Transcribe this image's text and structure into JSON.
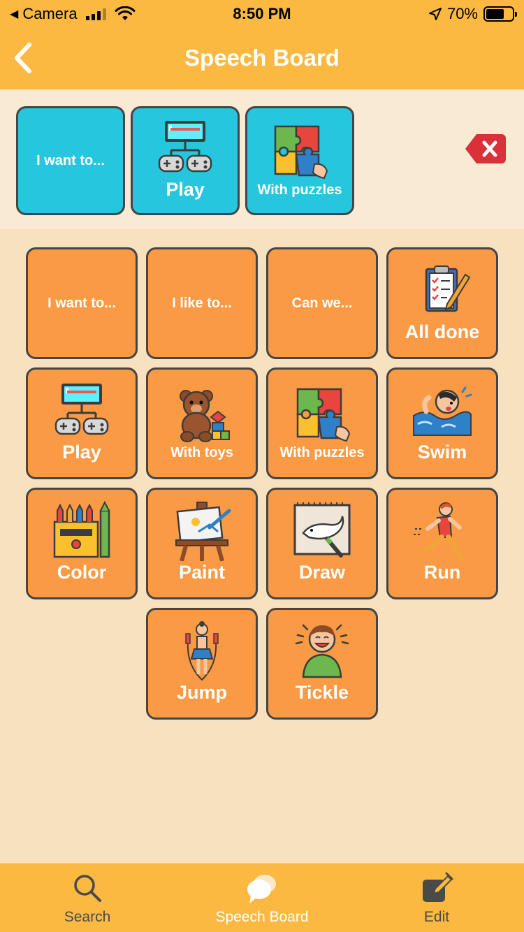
{
  "status_bar": {
    "back_app": "Camera",
    "time": "8:50 PM",
    "battery": "70%",
    "battery_level": 0.7
  },
  "nav": {
    "title": "Speech Board",
    "back_icon": "chevron-left-icon"
  },
  "sentence": [
    {
      "label": "I want to...",
      "icon": null
    },
    {
      "label": "Play",
      "icon": "game-console-icon"
    },
    {
      "label": "With puzzles",
      "icon": "puzzle-icon"
    }
  ],
  "delete_icon": "backspace-icon",
  "grid": [
    {
      "label": "I want to...",
      "icon": null
    },
    {
      "label": "I like to...",
      "icon": null
    },
    {
      "label": "Can we...",
      "icon": null
    },
    {
      "label": "All done",
      "icon": "checklist-icon"
    },
    {
      "label": "Play",
      "icon": "game-console-icon"
    },
    {
      "label": "With toys",
      "icon": "teddy-bear-icon"
    },
    {
      "label": "With puzzles",
      "icon": "puzzle-icon"
    },
    {
      "label": "Swim",
      "icon": "swimmer-icon"
    },
    {
      "label": "Color",
      "icon": "crayons-icon"
    },
    {
      "label": "Paint",
      "icon": "easel-icon"
    },
    {
      "label": "Draw",
      "icon": "drawing-icon"
    },
    {
      "label": "Run",
      "icon": "runner-icon"
    },
    {
      "label": "Jump",
      "icon": "jump-rope-icon"
    },
    {
      "label": "Tickle",
      "icon": "laughing-kid-icon"
    }
  ],
  "tabs": [
    {
      "label": "Search",
      "icon": "search-icon",
      "active": false
    },
    {
      "label": "Speech Board",
      "icon": "speech-bubbles-icon",
      "active": true
    },
    {
      "label": "Edit",
      "icon": "edit-icon",
      "active": false
    }
  ],
  "colors": {
    "bar": "#fbb942",
    "tile_orange": "#fa9a45",
    "tile_blue": "#25c6de",
    "background": "#f7e1bf",
    "delete_red": "#d9303a"
  }
}
